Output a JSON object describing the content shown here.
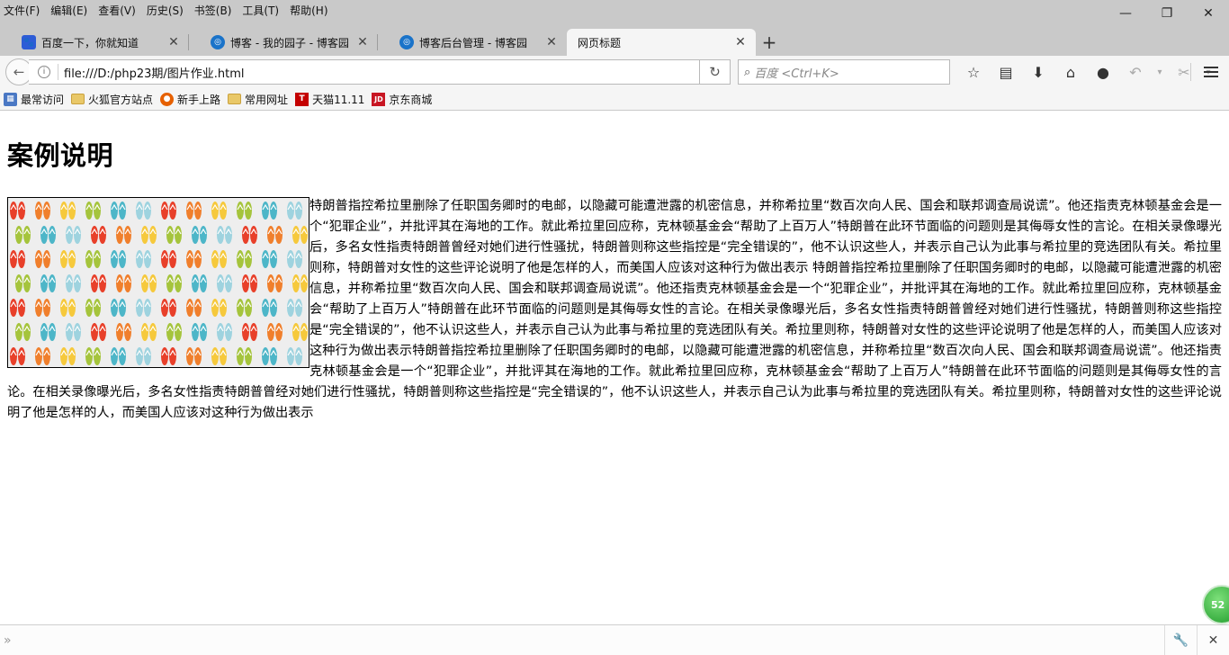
{
  "menubar": {
    "items": [
      "文件(F)",
      "编辑(E)",
      "查看(V)",
      "历史(S)",
      "书签(B)",
      "工具(T)",
      "帮助(H)"
    ]
  },
  "tabs": [
    {
      "title": "百度一下，你就知道",
      "favicon": "baidu-icon",
      "active": false
    },
    {
      "title": "博客 - 我的园子 - 博客园",
      "favicon": "cnblogs-icon",
      "active": false
    },
    {
      "title": "博客后台管理 - 博客园",
      "favicon": "cnblogs-icon",
      "active": false
    },
    {
      "title": "网页标题",
      "favicon": "",
      "active": true
    }
  ],
  "navbar": {
    "url": "file:///D:/php23期/图片作业.html",
    "search_placeholder": "百度 <Ctrl+K>"
  },
  "bookmarks": [
    {
      "label": "最常访问",
      "icon": "most-visited-icon"
    },
    {
      "label": "火狐官方站点",
      "icon": "folder-icon"
    },
    {
      "label": "新手上路",
      "icon": "firefox-icon"
    },
    {
      "label": "常用网址",
      "icon": "folder-icon"
    },
    {
      "label": "天猫11.11",
      "icon": "tmall-icon"
    },
    {
      "label": "京东商城",
      "icon": "jd-icon"
    }
  ],
  "page": {
    "heading": "案例说明",
    "image_alt": "flip-flops pattern",
    "body": "特朗普指控希拉里删除了任职国务卿时的电邮，以隐藏可能遭泄露的机密信息，并称希拉里“数百次向人民、国会和联邦调查局说谎”。他还指责克林顿基金会是一个“犯罪企业”，并批评其在海地的工作。就此希拉里回应称，克林顿基金会“帮助了上百万人”特朗普在此环节面临的问题则是其侮辱女性的言论。在相关录像曝光后，多名女性指责特朗普曾经对她们进行性骚扰，特朗普则称这些指控是“完全错误的”，他不认识这些人，并表示自己认为此事与希拉里的竞选团队有关。希拉里则称，特朗普对女性的这些评论说明了他是怎样的人，而美国人应该对这种行为做出表示 特朗普指控希拉里删除了任职国务卿时的电邮，以隐藏可能遭泄露的机密信息，并称希拉里“数百次向人民、国会和联邦调查局说谎”。他还指责克林顿基金会是一个“犯罪企业”，并批评其在海地的工作。就此希拉里回应称，克林顿基金会“帮助了上百万人”特朗普在此环节面临的问题则是其侮辱女性的言论。在相关录像曝光后，多名女性指责特朗普曾经对她们进行性骚扰，特朗普则称这些指控是“完全错误的”，他不认识这些人，并表示自己认为此事与希拉里的竞选团队有关。希拉里则称，特朗普对女性的这些评论说明了他是怎样的人，而美国人应该对这种行为做出表示特朗普指控希拉里删除了任职国务卿时的电邮，以隐藏可能遭泄露的机密信息，并称希拉里“数百次向人民、国会和联邦调查局说谎”。他还指责克林顿基金会是一个“犯罪企业”，并批评其在海地的工作。就此希拉里回应称，克林顿基金会“帮助了上百万人”特朗普在此环节面临的问题则是其侮辱女性的言论。在相关录像曝光后，多名女性指责特朗普曾经对她们进行性骚扰，特朗普则称这些指控是“完全错误的”，他不认识这些人，并表示自己认为此事与希拉里的竞选团队有关。希拉里则称，特朗普对女性的这些评论说明了他是怎样的人，而美国人应该对这种行为做出表示"
  },
  "badge": {
    "text": "52"
  },
  "colors": {
    "chrome": "#c9c9c9",
    "toolbar": "#f5f5f5",
    "flipflop_palette": [
      "#e8402a",
      "#f07f2c",
      "#f6c93c",
      "#a5c43c",
      "#4db6c8",
      "#9ed3df"
    ]
  }
}
